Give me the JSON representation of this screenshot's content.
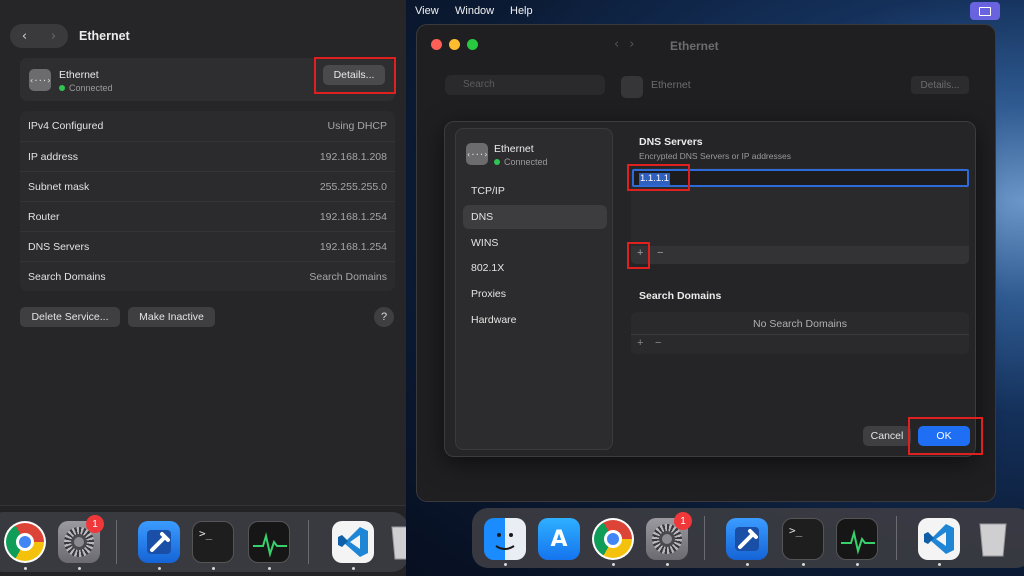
{
  "left": {
    "window_title": "Ethernet",
    "nav": {
      "back": "‹",
      "forward": "›"
    },
    "service": {
      "icon": "ethernet-icon",
      "icon_glyph": "‹···›",
      "name": "Ethernet",
      "status": "Connected",
      "details_label": "Details..."
    },
    "rows": [
      {
        "label": "IPv4 Configured",
        "value": "Using DHCP"
      },
      {
        "label": "IP address",
        "value": "192.168.1.208"
      },
      {
        "label": "Subnet mask",
        "value": "255.255.255.0"
      },
      {
        "label": "Router",
        "value": "192.168.1.254"
      },
      {
        "label": "DNS Servers",
        "value": "192.168.1.254"
      },
      {
        "label": "Search Domains",
        "value": "Search Domains"
      }
    ],
    "delete_label": "Delete Service...",
    "inactive_label": "Make Inactive",
    "help_label": "?"
  },
  "dock_left": {
    "badge": "1",
    "terminal_glyph": ">_"
  },
  "menubar": {
    "items": [
      "View",
      "Window",
      "Help"
    ]
  },
  "background_window": {
    "title": "Ethernet",
    "search_placeholder": "Search",
    "service_name": "Ethernet",
    "details_label": "Details..."
  },
  "sheet": {
    "service": {
      "name": "Ethernet",
      "status": "Connected",
      "icon_glyph": "‹···›"
    },
    "sidebar_items": [
      "TCP/IP",
      "DNS",
      "WINS",
      "802.1X",
      "Proxies",
      "Hardware"
    ],
    "selected_item": "DNS",
    "dns": {
      "title": "DNS Servers",
      "subtitle": "Encrypted DNS Servers or IP addresses",
      "entries": [
        "1.1.1.1"
      ],
      "add": "+",
      "remove": "−"
    },
    "search_domains": {
      "title": "Search Domains",
      "empty": "No Search Domains",
      "add": "+",
      "remove": "−"
    },
    "cancel_label": "Cancel",
    "ok_label": "OK"
  },
  "dock_right": {
    "badge": "1",
    "terminal_glyph": ">_",
    "appstore_glyph": "A"
  },
  "colors": {
    "accent": "#1f6ff5",
    "highlight": "#e0201f",
    "connected": "#30c453"
  }
}
